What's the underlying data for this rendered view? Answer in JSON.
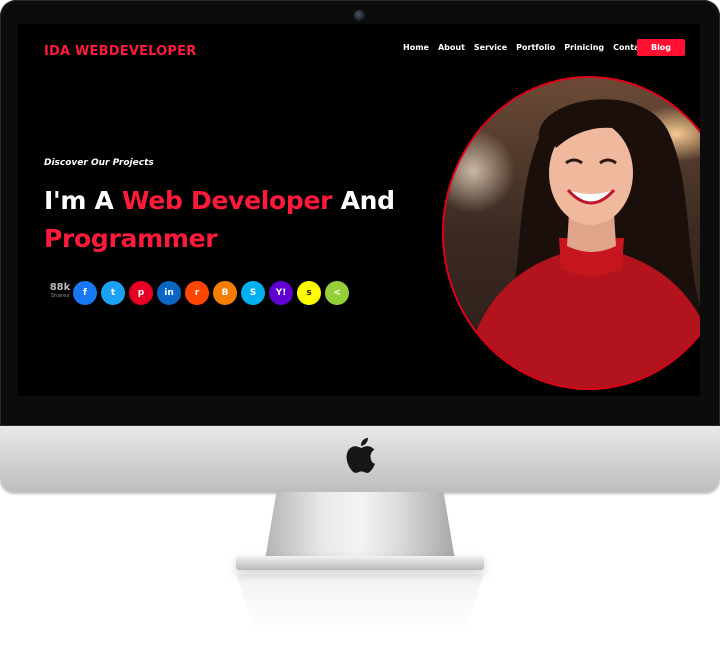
{
  "brand": "IDA WEBDEVELOPER",
  "nav": {
    "items": [
      "Home",
      "About",
      "Service",
      "Portfolio",
      "Prinicing",
      "Contact"
    ],
    "cta": "Blog"
  },
  "hero": {
    "kicker": "Discover Our Projects",
    "headline_part1": "I'm A ",
    "headline_highlight": "Web Developer",
    "headline_part2": " And",
    "headline_line2": "Programmer"
  },
  "shares": {
    "count": "88k",
    "label": "Shares"
  },
  "social": [
    {
      "name": "facebook-icon",
      "glyph": "f",
      "color": "#1877f2"
    },
    {
      "name": "twitter-icon",
      "glyph": "t",
      "color": "#1da1f2"
    },
    {
      "name": "pinterest-icon",
      "glyph": "p",
      "color": "#e60023"
    },
    {
      "name": "linkedin-icon",
      "glyph": "in",
      "color": "#0a66c2"
    },
    {
      "name": "reddit-icon",
      "glyph": "r",
      "color": "#ff4500"
    },
    {
      "name": "blogger-icon",
      "glyph": "B",
      "color": "#f57d00"
    },
    {
      "name": "skype-icon",
      "glyph": "S",
      "color": "#00aff0"
    },
    {
      "name": "yahoo-icon",
      "glyph": "Y!",
      "color": "#6001d2"
    },
    {
      "name": "snapchat-icon",
      "glyph": "s",
      "color": "#fffc00"
    },
    {
      "name": "share-icon",
      "glyph": "<",
      "color": "#95d03a"
    }
  ],
  "colors": {
    "accent": "#ff1a3a",
    "background": "#000000"
  }
}
